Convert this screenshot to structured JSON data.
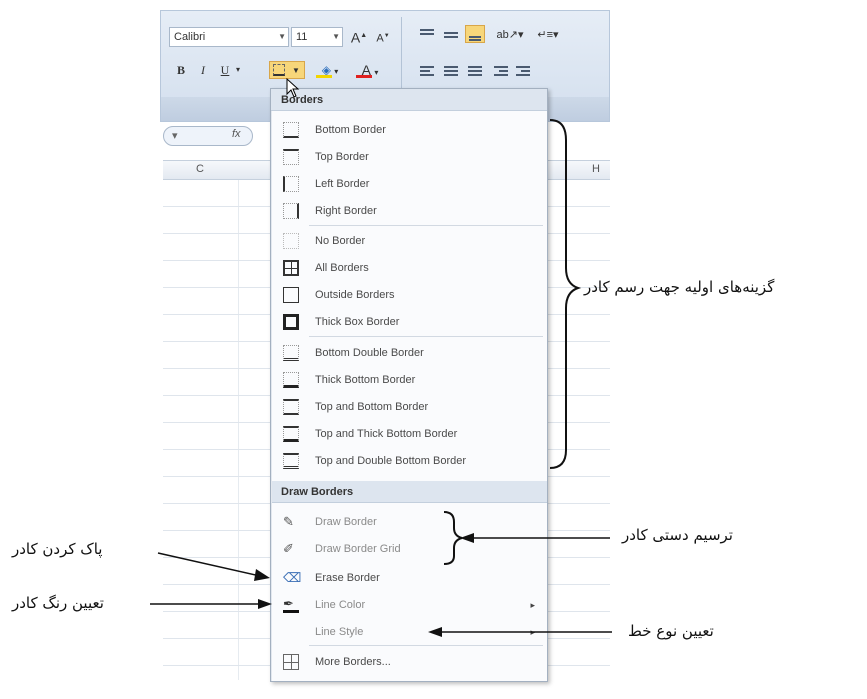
{
  "ribbon": {
    "font_name": "Calibri",
    "font_size": "11",
    "grow_font": "A",
    "shrink_font": "A",
    "bold": "B",
    "italic": "I",
    "underline": "U"
  },
  "formula_bar": {
    "fx": "fx"
  },
  "columns": {
    "c": "C",
    "h": "H"
  },
  "menu": {
    "header_borders": "Borders",
    "border_items": [
      "Bottom Border",
      "Top Border",
      "Left Border",
      "Right Border",
      "No Border",
      "All Borders",
      "Outside Borders",
      "Thick Box Border",
      "Bottom Double Border",
      "Thick Bottom Border",
      "Top and Bottom Border",
      "Top and Thick Bottom Border",
      "Top and Double Bottom Border"
    ],
    "header_draw": "Draw Borders",
    "draw_items": [
      "Draw Border",
      "Draw Border Grid",
      "Erase Border",
      "Line Color",
      "Line Style",
      "More Borders..."
    ],
    "submenu_arrow": "▸"
  },
  "annotations": {
    "primary_options": "گزینه‌های اولیه جهت رسم کادر",
    "manual_draw": "ترسیم دستی کادر",
    "erase": "پاک کردن کادر",
    "line_color": "تعیین رنگ کادر",
    "line_style": "تعیین نوع خط"
  },
  "colors": {
    "highlight": "#f7d67a",
    "menu_header": "#dde5ef",
    "ribbon": "#d3dfee"
  }
}
